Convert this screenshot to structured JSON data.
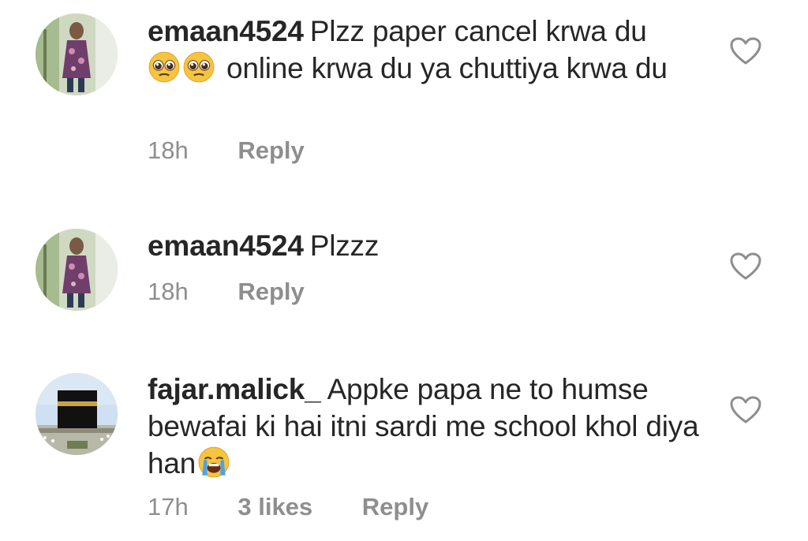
{
  "comments": [
    {
      "username": "emaan4524",
      "text_part1": "Plzz paper cancel krwa du",
      "emoji_pair": "pleading-face-emoji",
      "text_part2": "online krwa du ya chuttiya krwa du",
      "time": "18h",
      "reply_label": "Reply"
    },
    {
      "username": "emaan4524",
      "text": "Plzzz",
      "time": "18h",
      "reply_label": "Reply"
    },
    {
      "username": "fajar.malick_",
      "text": "Appke papa ne to humse bewafai ki hai itni sardi me school khol diya han",
      "emoji": "loudly-crying-face-emoji",
      "time": "17h",
      "likes": "3 likes",
      "reply_label": "Reply"
    }
  ],
  "colors": {
    "text": "#262626",
    "meta": "#8e8e8e",
    "heart_outline": "#8e8e8e",
    "emoji_yellow": "#f7c440"
  }
}
